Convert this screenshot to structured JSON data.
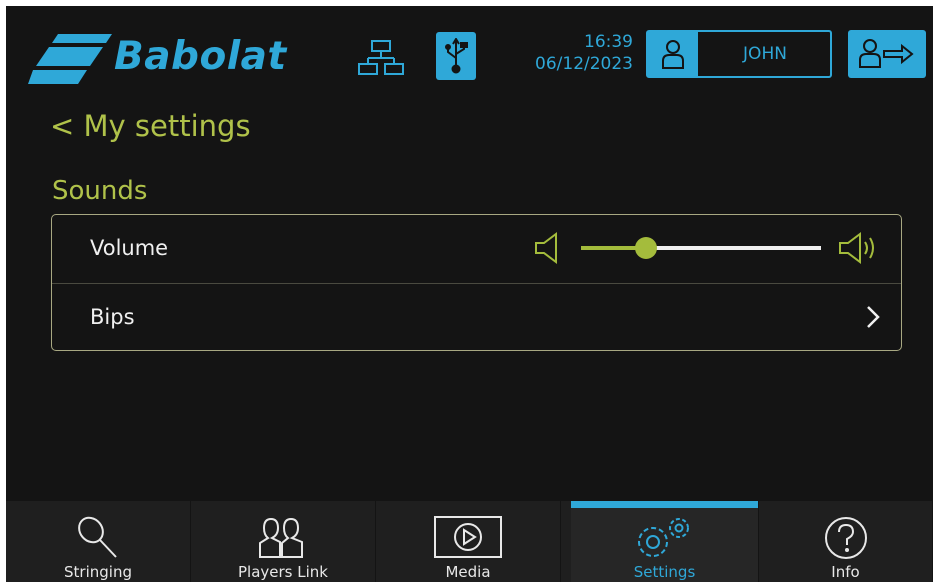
{
  "header": {
    "brand": "Babolat",
    "time": "16:39",
    "date": "06/12/2023",
    "user": "JOHN",
    "accent_color": "#2fa8d8"
  },
  "page": {
    "back_label": "< My settings",
    "section_title": "Sounds",
    "title_color": "#b0c24a"
  },
  "settings": {
    "volume_label": "Volume",
    "volume_level": 0.27,
    "bips_label": "Bips"
  },
  "nav": {
    "tabs": [
      {
        "label": "Stringing",
        "icon": "racket-icon"
      },
      {
        "label": "Players Link",
        "icon": "players-icon"
      },
      {
        "label": "Media",
        "icon": "play-icon"
      },
      {
        "label": "Settings",
        "icon": "gear-icon",
        "active": true
      },
      {
        "label": "Info",
        "icon": "question-icon"
      }
    ]
  }
}
